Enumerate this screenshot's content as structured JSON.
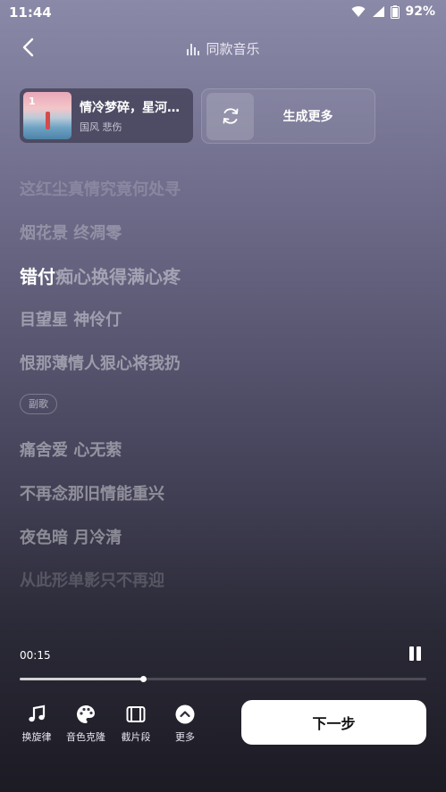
{
  "status": {
    "time": "11:44",
    "battery": "92%"
  },
  "header": {
    "title": "同款音乐"
  },
  "song_card": {
    "index": "1",
    "title": "情冷梦碎，星河…",
    "tags": "国风 悲伤"
  },
  "generate": {
    "label": "生成更多"
  },
  "lyrics": {
    "line1": "这红尘真情究竟何处寻",
    "line2": "烟花景 终凋零",
    "line3_highlight": "错付",
    "line3_rest": "痴心换得满心疼",
    "line4": "目望星 神伶仃",
    "line5": "恨那薄情人狠心将我扔",
    "chorus_tag": "副歌",
    "line6": "痛舍爱 心无萦",
    "line7": "不再念那旧情能重兴",
    "line8": "夜色暗 月冷清",
    "line9": "从此形单影只不再迎"
  },
  "player": {
    "current_time": "00:15",
    "progress": 0.304
  },
  "toolbar": {
    "melody_label": "换旋律",
    "voice_label": "音色克隆",
    "clip_label": "截片段",
    "more_label": "更多",
    "next_label": "下一步"
  }
}
